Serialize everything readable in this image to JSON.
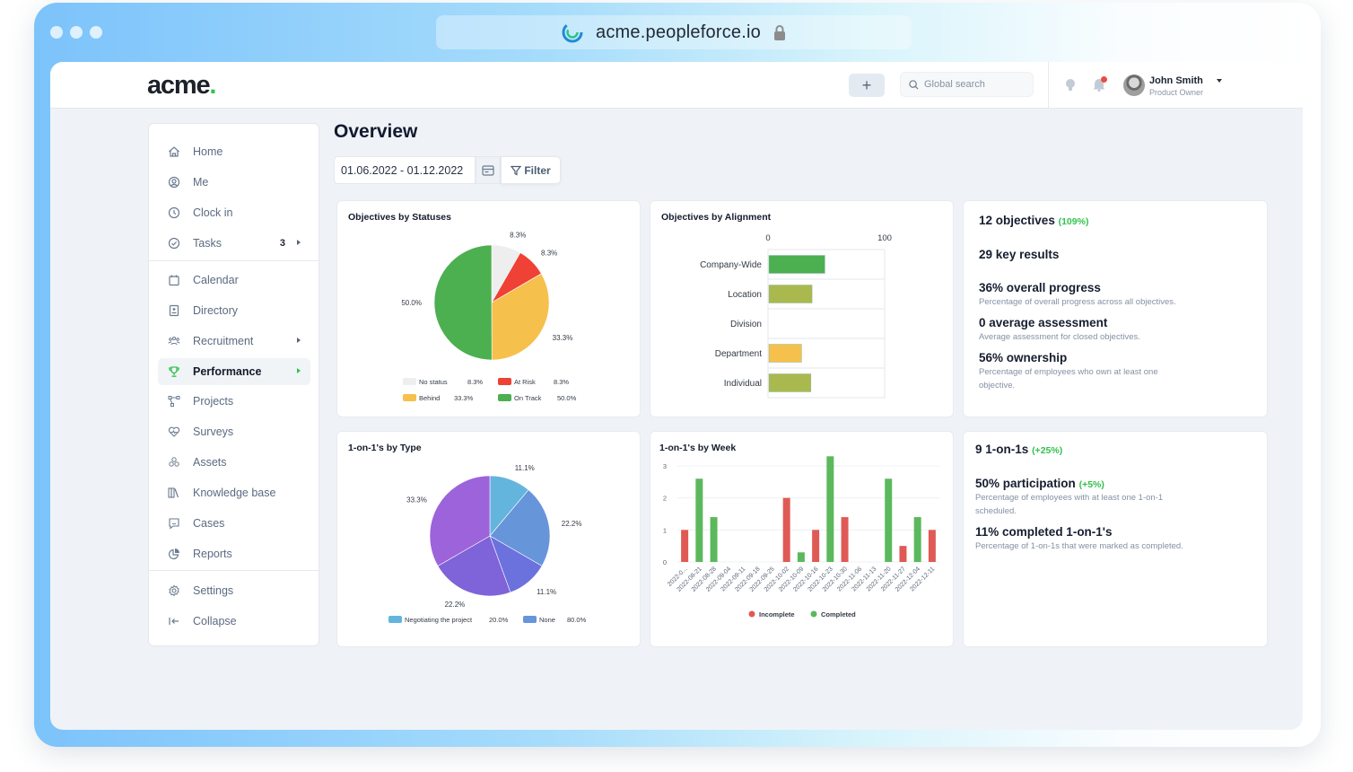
{
  "browser": {
    "url": "acme.peopleforce.io",
    "site_icon": "peopleforce-logo-icon",
    "secure_icon": "lock-icon"
  },
  "header": {
    "logo_text": "acme",
    "logo_dot": ".",
    "add_button_label": "+",
    "search_placeholder": "Global search",
    "user": {
      "name": "John Smith",
      "role": "Product Owner"
    },
    "icons": [
      "lightbulb-icon",
      "bell-icon"
    ]
  },
  "sidebar": {
    "items": [
      {
        "label": "Home",
        "icon": "home-icon"
      },
      {
        "label": "Me",
        "icon": "user-circle-icon"
      },
      {
        "label": "Clock in",
        "icon": "clock-icon"
      },
      {
        "label": "Tasks",
        "icon": "check-circle-icon",
        "count": "3",
        "has_submenu": true
      },
      {
        "label": "Calendar",
        "icon": "calendar-icon"
      },
      {
        "label": "Directory",
        "icon": "contact-book-icon"
      },
      {
        "label": "Recruitment",
        "icon": "people-group-icon",
        "has_submenu": true
      },
      {
        "label": "Performance",
        "icon": "trophy-icon",
        "has_submenu": true,
        "active": true
      },
      {
        "label": "Projects",
        "icon": "project-nodes-icon"
      },
      {
        "label": "Surveys",
        "icon": "heart-pulse-icon"
      },
      {
        "label": "Assets",
        "icon": "boxes-icon"
      },
      {
        "label": "Knowledge base",
        "icon": "books-icon"
      },
      {
        "label": "Cases",
        "icon": "chat-smile-icon"
      },
      {
        "label": "Reports",
        "icon": "pie-chart-icon"
      },
      {
        "label": "Settings",
        "icon": "gear-icon"
      },
      {
        "label": "Collapse",
        "icon": "collapse-left-icon"
      }
    ]
  },
  "main": {
    "title": "Overview",
    "date_range": "01.06.2022 - 01.12.2022",
    "filter_label": "Filter",
    "objectives_summary": {
      "objectives": {
        "value": "12",
        "label": "objectives",
        "delta": "(109%)"
      },
      "key_results": {
        "value": "29",
        "label": "key results"
      },
      "overall_progress": {
        "value": "36%",
        "label": "overall progress",
        "desc": "Percentage of overall progress across all objectives."
      },
      "average_assessment": {
        "value": "0",
        "label": "average assessment",
        "desc": "Average assessment for closed objectives."
      },
      "ownership": {
        "value": "56%",
        "label": "ownership",
        "desc": "Percentage of employees who own at least one objective."
      }
    },
    "one_on_ones_summary": {
      "count": {
        "value": "9",
        "label": "1-on-1s",
        "delta": "(+25%)"
      },
      "participation": {
        "value": "50%",
        "label": "participation",
        "delta": "(+5%)",
        "desc": "Percentage of employees with at least one 1-on-1 scheduled."
      },
      "completed": {
        "value": "11%",
        "label": "completed 1-on-1's",
        "desc": "Percentage of 1-on-1s that were marked as completed."
      }
    }
  },
  "chart_data": [
    {
      "id": "objectives_by_statuses",
      "type": "pie",
      "title": "Objectives by Statuses",
      "slices": [
        {
          "label": "No status",
          "value": 8.3,
          "color": "#eeeeee"
        },
        {
          "label": "At Risk",
          "value": 8.3,
          "color": "#ef4136"
        },
        {
          "label": "Behind",
          "value": 33.3,
          "color": "#f6c04c"
        },
        {
          "label": "On Track",
          "value": 50.0,
          "color": "#4caf50"
        }
      ],
      "legend": [
        {
          "label": "No status",
          "value": "8.3%",
          "color": "#eeeeee"
        },
        {
          "label": "At Risk",
          "value": "8.3%",
          "color": "#ef4136"
        },
        {
          "label": "Behind",
          "value": "33.3%",
          "color": "#f6c04c"
        },
        {
          "label": "On Track",
          "value": "50.0%",
          "color": "#4caf50"
        }
      ]
    },
    {
      "id": "objectives_by_alignment",
      "type": "bar",
      "orientation": "horizontal",
      "title": "Objectives by Alignment",
      "categories": [
        "Company-Wide",
        "Location",
        "Division",
        "Department",
        "Individual"
      ],
      "values": [
        48,
        37,
        0,
        28,
        36
      ],
      "colors": [
        "#4caf50",
        "#aab94d",
        "#aab94d",
        "#f6c04c",
        "#aab94d"
      ],
      "xlim": [
        0,
        100
      ],
      "xticks": [
        "0",
        "100"
      ]
    },
    {
      "id": "one_on_ones_by_type",
      "type": "pie",
      "title": "1-on-1's by Type",
      "slices": [
        {
          "label": "11.1%",
          "value": 11.1,
          "color": "#64b5dd"
        },
        {
          "label": "22.2%",
          "value": 22.2,
          "color": "#6695d9"
        },
        {
          "label": "11.1%",
          "value": 11.1,
          "color": "#6b71dd"
        },
        {
          "label": "22.2%",
          "value": 22.2,
          "color": "#7f63d9"
        },
        {
          "label": "33.3%",
          "value": 33.3,
          "color": "#9d63da"
        }
      ],
      "legend": [
        {
          "label": "Negotiating the project",
          "value": "20.0%",
          "color": "#64b5dd"
        },
        {
          "label": "None",
          "value": "80.0%",
          "color": "#6695d9"
        }
      ]
    },
    {
      "id": "one_on_ones_by_week",
      "type": "bar",
      "title": "1-on-1's by Week",
      "categories": [
        "2022-0...",
        "2022-08-21",
        "2022-08-28",
        "2022-09-04",
        "2022-09-11",
        "2022-09-18",
        "2022-09-25",
        "2022-10-02",
        "2022-10-09",
        "2022-10-16",
        "2022-10-23",
        "2022-10-30",
        "2022-11-06",
        "2022-11-13",
        "2022-11-20",
        "2022-11-27",
        "2022-12-04",
        "2022-12-11"
      ],
      "series": [
        {
          "name": "Incomplete",
          "color": "#e05a55",
          "values": [
            1,
            0,
            0,
            0,
            0,
            0,
            0,
            2,
            0,
            1,
            0,
            1.4,
            0,
            0,
            0,
            0.5,
            0,
            1
          ]
        },
        {
          "name": "Completed",
          "color": "#5cb85c",
          "values": [
            0,
            2.6,
            1.4,
            0,
            0,
            0,
            0,
            0,
            0.3,
            0,
            3.3,
            0,
            0,
            0,
            2.6,
            0,
            1.4,
            0
          ]
        }
      ],
      "ylim": [
        0,
        3.3
      ],
      "yticks": [
        "0",
        "1",
        "2",
        "3"
      ],
      "legend_position": "bottom"
    }
  ]
}
